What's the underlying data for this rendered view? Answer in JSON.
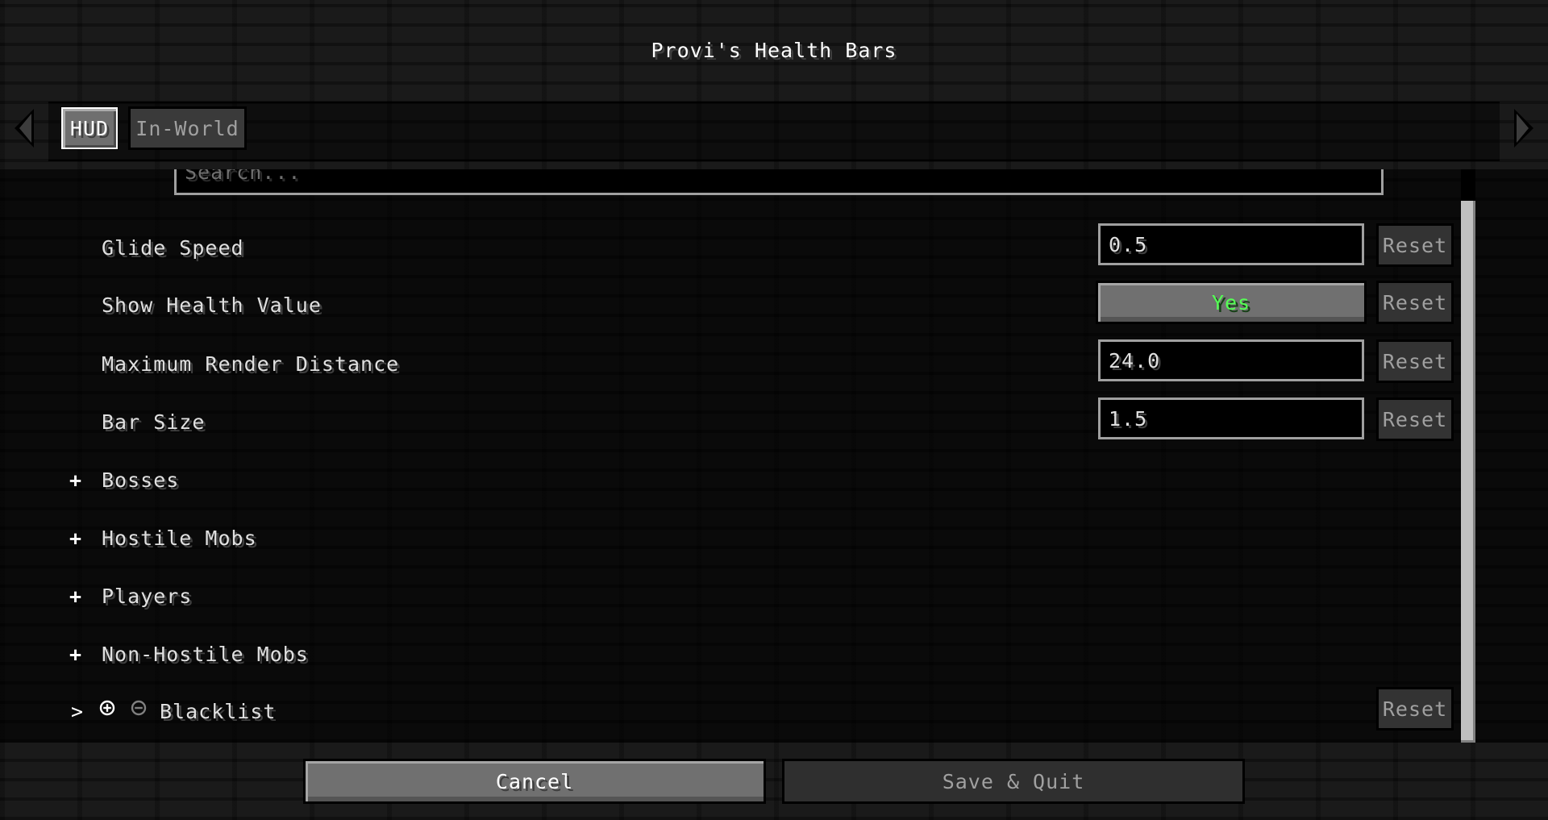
{
  "title": "Provi's Health Bars",
  "tabs": [
    {
      "label": "HUD",
      "selected": true
    },
    {
      "label": "In-World",
      "selected": false
    }
  ],
  "navigation": {
    "left_arrow": "arrow-left-icon",
    "right_arrow": "arrow-right-icon"
  },
  "search": {
    "placeholder": "Search..."
  },
  "options": [
    {
      "label": "Glide Speed",
      "type": "text",
      "value": "0.5",
      "reset_label": "Reset"
    },
    {
      "label": "Show Health Value",
      "type": "toggle",
      "value": "Yes",
      "value_color": "#55ff55",
      "reset_label": "Reset"
    },
    {
      "label": "Maximum Render Distance",
      "type": "text",
      "value": "24.0",
      "reset_label": "Reset"
    },
    {
      "label": "Bar Size",
      "type": "text",
      "value": "1.5",
      "reset_label": "Reset"
    }
  ],
  "categories": [
    {
      "label": "Bosses",
      "icon": "+"
    },
    {
      "label": "Hostile Mobs",
      "icon": "+"
    },
    {
      "label": "Players",
      "icon": "+"
    },
    {
      "label": "Non-Hostile Mobs",
      "icon": "+"
    }
  ],
  "blacklist": {
    "chevron": ">",
    "label": "Blacklist",
    "reset_label": "Reset"
  },
  "footer": {
    "cancel_label": "Cancel",
    "save_label": "Save & Quit"
  }
}
